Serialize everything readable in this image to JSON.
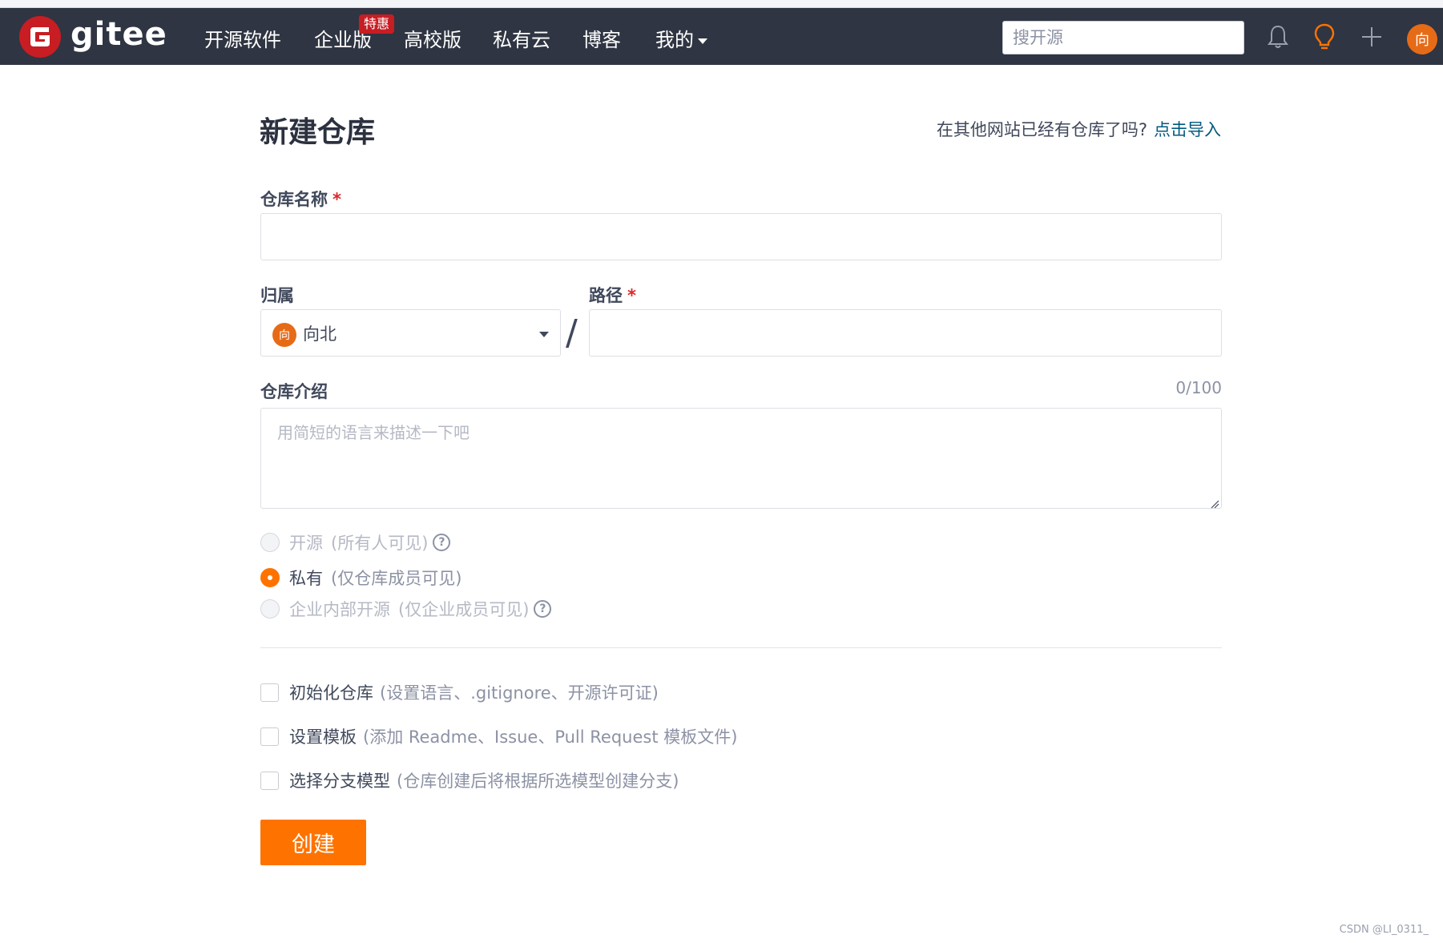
{
  "header": {
    "logo_text": "gitee",
    "nav": [
      {
        "label": "开源软件"
      },
      {
        "label": "企业版",
        "badge": "特惠"
      },
      {
        "label": "高校版"
      },
      {
        "label": "私有云"
      },
      {
        "label": "博客"
      },
      {
        "label": "我的",
        "has_dropdown": true
      }
    ],
    "search_placeholder": "搜开源",
    "icons": [
      "bell-icon",
      "lightbulb-icon",
      "plus-icon"
    ],
    "avatar_text": "向",
    "colors": {
      "navbar_bg": "#2f3542",
      "brand_red": "#c71d23",
      "accent_orange": "#fe7300"
    }
  },
  "form": {
    "title": "新建仓库",
    "import_hint": "在其他网站已经有仓库了吗?",
    "import_link": "点击导入",
    "repo_name_label": "仓库名称",
    "repo_name_value": "",
    "required_mark": "*",
    "owner_label": "归属",
    "owner_avatar_text": "向",
    "owner_value": "向北",
    "separator": "/",
    "path_label": "路径",
    "path_value": "",
    "intro_label": "仓库介绍",
    "intro_counter": "0/100",
    "intro_placeholder": "用简短的语言来描述一下吧",
    "visibility": [
      {
        "label": "开源",
        "sub": "(所有人可见)",
        "checked": false,
        "disabled": true,
        "help": true
      },
      {
        "label": "私有",
        "sub": "(仅仓库成员可见)",
        "checked": true,
        "disabled": false,
        "help": false
      },
      {
        "label": "企业内部开源",
        "sub": "(仅企业成员可见)",
        "checked": false,
        "disabled": true,
        "help": true
      }
    ],
    "options": [
      {
        "label": "初始化仓库",
        "sub": "(设置语言、.gitignore、开源许可证)",
        "checked": false
      },
      {
        "label": "设置模板",
        "sub": "(添加 Readme、Issue、Pull Request 模板文件)",
        "checked": false
      },
      {
        "label": "选择分支模型",
        "sub": "(仓库创建后将根据所选模型创建分支)",
        "checked": false
      }
    ],
    "submit_label": "创建"
  },
  "watermark": "CSDN @LI_0311_"
}
